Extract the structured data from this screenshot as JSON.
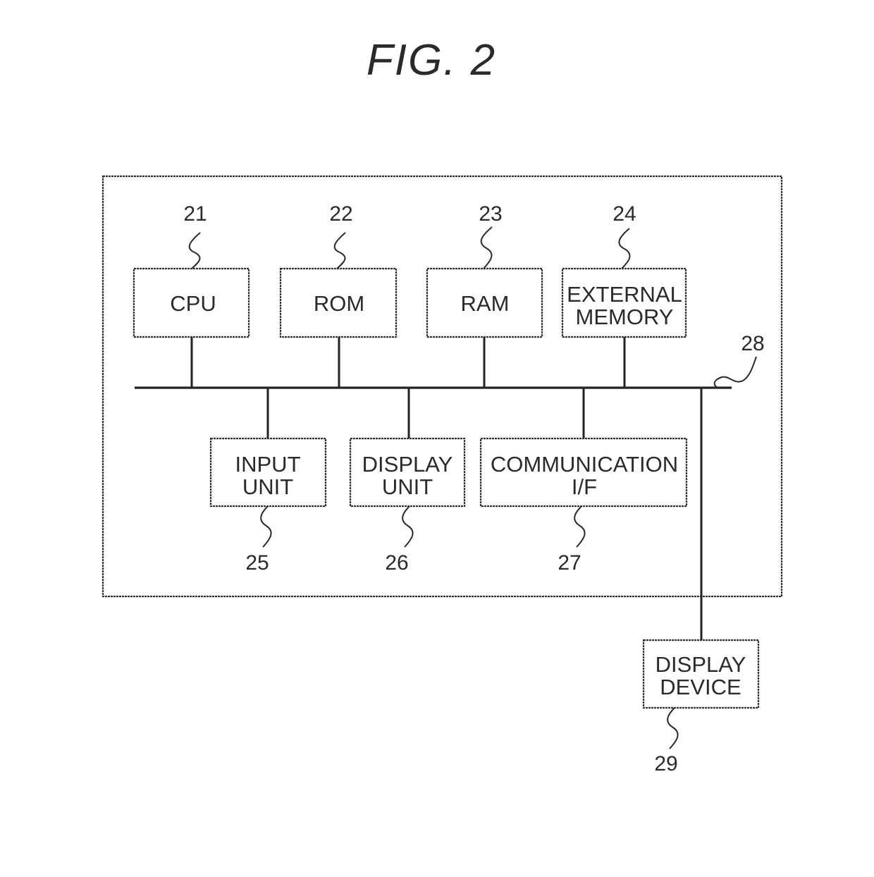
{
  "figure": {
    "title": "FIG. 2"
  },
  "blocks": {
    "cpu": {
      "ref": "21",
      "lines": [
        "CPU"
      ]
    },
    "rom": {
      "ref": "22",
      "lines": [
        "ROM"
      ]
    },
    "ram": {
      "ref": "23",
      "lines": [
        "RAM"
      ]
    },
    "external_memory": {
      "ref": "24",
      "lines": [
        "EXTERNAL",
        "MEMORY"
      ]
    },
    "input_unit": {
      "ref": "25",
      "lines": [
        "INPUT",
        "UNIT"
      ]
    },
    "display_unit": {
      "ref": "26",
      "lines": [
        "DISPLAY",
        "UNIT"
      ]
    },
    "communication_if": {
      "ref": "27",
      "lines": [
        "COMMUNICATION",
        "I/F"
      ]
    },
    "display_device": {
      "ref": "29",
      "lines": [
        "DISPLAY",
        "DEVICE"
      ]
    }
  },
  "bus": {
    "ref": "28"
  }
}
